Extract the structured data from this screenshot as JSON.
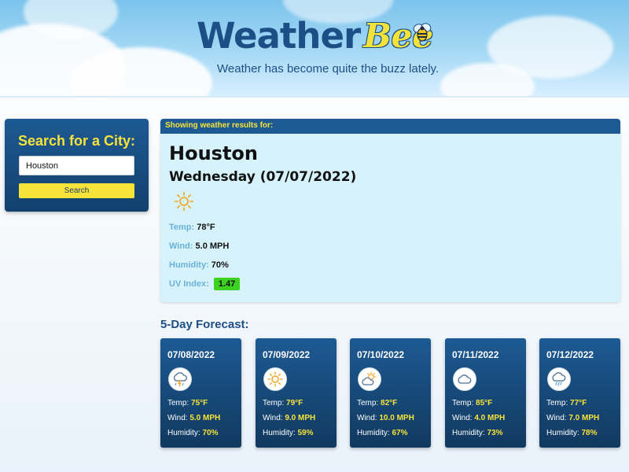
{
  "header": {
    "logo_weather": "Weather",
    "logo_bee": "Bee",
    "tagline": "Weather has become quite the buzz lately."
  },
  "search": {
    "title": "Search for a City:",
    "input_value": "Houston",
    "button_label": "Search"
  },
  "current": {
    "header_label": "Showing weather results for:",
    "city": "Houston",
    "date": "Wednesday (07/07/2022)",
    "icon": "sun-icon",
    "temp_label": "Temp:",
    "temp": "78°F",
    "wind_label": "Wind:",
    "wind": "5.0 MPH",
    "humidity_label": "Humidity:",
    "humidity": "70%",
    "uv_label": "UV Index:",
    "uv": "1.47",
    "uv_color": "#3bd221"
  },
  "forecast": {
    "title": "5-Day Forecast:",
    "temp_label": "Temp:",
    "wind_label": "Wind:",
    "humidity_label": "Humidity:",
    "days": [
      {
        "date": "07/08/2022",
        "icon": "thunderstorm-icon",
        "temp": "75°F",
        "wind": "5.0 MPH",
        "humidity": "70%"
      },
      {
        "date": "07/09/2022",
        "icon": "sun-icon",
        "temp": "79°F",
        "wind": "9.0 MPH",
        "humidity": "59%"
      },
      {
        "date": "07/10/2022",
        "icon": "partly-cloudy-icon",
        "temp": "82°F",
        "wind": "10.0 MPH",
        "humidity": "67%"
      },
      {
        "date": "07/11/2022",
        "icon": "cloud-icon",
        "temp": "85°F",
        "wind": "4.0 MPH",
        "humidity": "73%"
      },
      {
        "date": "07/12/2022",
        "icon": "rain-cloud-icon",
        "temp": "77°F",
        "wind": "7.0 MPH",
        "humidity": "78%"
      }
    ]
  },
  "colors": {
    "navy": "#1d5a93",
    "yellow": "#f8e33a",
    "light_blue_panel": "#d6f3fc",
    "label_blue": "#6ab1d8"
  }
}
